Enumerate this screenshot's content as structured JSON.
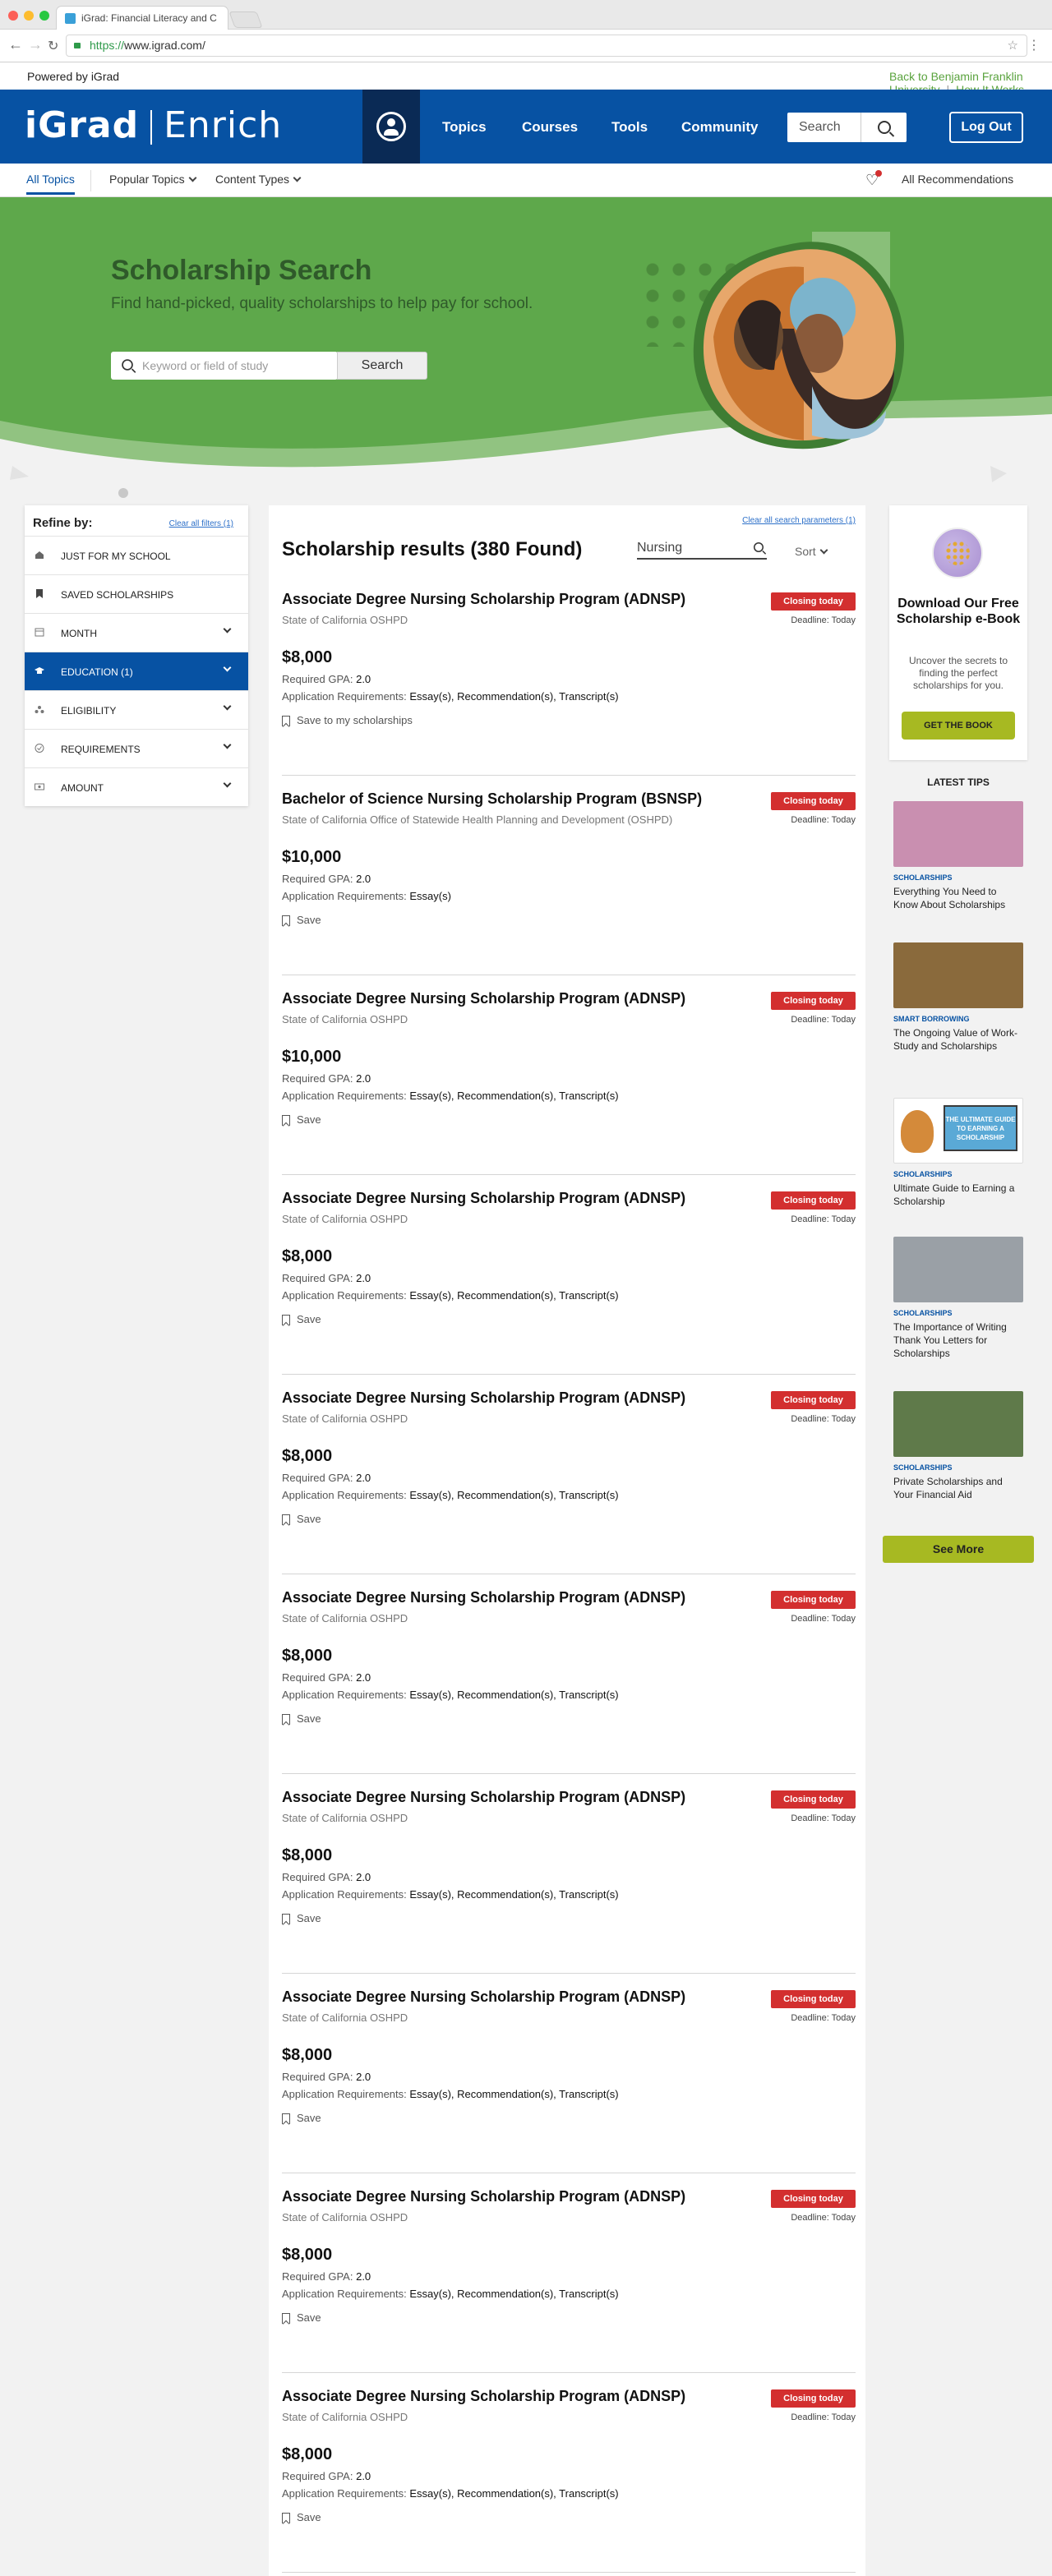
{
  "browser": {
    "tab_title": "iGrad: Financial Literacy and C",
    "url_scheme": "https://",
    "url_host": "www.igrad.com/"
  },
  "utility_bar": {
    "powered_by": "Powered by iGrad",
    "back_link": "Back to  Benjamin Franklin University",
    "how_it_works": "How It Works"
  },
  "header": {
    "logo_left": "iGrad",
    "logo_right": "Enrich",
    "nav": [
      "Topics",
      "Courses",
      "Tools",
      "Community"
    ],
    "search_placeholder": "Search",
    "logout": "Log Out"
  },
  "subnav": {
    "all_topics": "All Topics",
    "popular_topics": "Popular Topics",
    "content_types": "Content Types",
    "recommendations": "All Recommendations"
  },
  "hero": {
    "title": "Scholarship Search",
    "subtitle": "Find hand-picked, quality scholarships to help pay for school.",
    "search_placeholder": "Keyword or field of study",
    "search_button": "Search"
  },
  "filters": {
    "title": "Refine by:",
    "clear": "Clear all filters (1)",
    "items": [
      {
        "label": "JUST FOR MY SCHOOL",
        "icon": "school-icon"
      },
      {
        "label": "SAVED SCHOLARSHIPS",
        "icon": "bookmark-icon"
      },
      {
        "label": "MONTH",
        "icon": "calendar-icon"
      },
      {
        "label": "EDUCATION (1)",
        "icon": "graduation-cap-icon"
      },
      {
        "label": "ELIGIBILITY",
        "icon": "people-icon"
      },
      {
        "label": "REQUIREMENTS",
        "icon": "check-circle-icon"
      },
      {
        "label": "AMOUNT",
        "icon": "money-icon"
      }
    ]
  },
  "results": {
    "clear_params": "Clear all search parameters (1)",
    "heading": "Scholarship results (380 Found)",
    "search_value": "Nursing",
    "sort_label": "Sort",
    "cards": [
      {
        "title": "Associate Degree Nursing Scholarship Program (ADNSP)",
        "provider": "State of California OSHPD",
        "badge": "Closing today",
        "deadline": "Deadline: Today",
        "amount": "$8,000",
        "gpa_label": "Required GPA: ",
        "gpa": "2.0",
        "req_label": "Application Requirements: ",
        "req": "Essay(s), Recommendation(s), Transcript(s)",
        "save": "Save to my scholarships"
      },
      {
        "title": "Bachelor of Science Nursing Scholarship Program (BSNSP)",
        "provider": "State of California Office of Statewide Health Planning and Development (OSHPD)",
        "badge": "Closing today",
        "deadline": "Deadline: Today",
        "amount": "$10,000",
        "gpa_label": "Required GPA: ",
        "gpa": "2.0",
        "req_label": "Application Requirements: ",
        "req": "Essay(s)",
        "save": "Save"
      },
      {
        "title": "Associate Degree Nursing Scholarship Program (ADNSP)",
        "provider": "State of California OSHPD",
        "badge": "Closing today",
        "deadline": "Deadline: Today",
        "amount": "$10,000",
        "gpa_label": "Required GPA: ",
        "gpa": "2.0",
        "req_label": "Application Requirements: ",
        "req": "Essay(s), Recommendation(s), Transcript(s)",
        "save": "Save"
      },
      {
        "title": "Associate Degree Nursing Scholarship Program (ADNSP)",
        "provider": "State of California OSHPD",
        "badge": "Closing today",
        "deadline": "Deadline: Today",
        "amount": "$8,000",
        "gpa_label": "Required GPA: ",
        "gpa": "2.0",
        "req_label": "Application Requirements: ",
        "req": "Essay(s), Recommendation(s), Transcript(s)",
        "save": "Save"
      },
      {
        "title": "Associate Degree Nursing Scholarship Program (ADNSP)",
        "provider": "State of California OSHPD",
        "badge": "Closing today",
        "deadline": "Deadline: Today",
        "amount": "$8,000",
        "gpa_label": "Required GPA: ",
        "gpa": "2.0",
        "req_label": "Application Requirements: ",
        "req": "Essay(s), Recommendation(s), Transcript(s)",
        "save": "Save"
      },
      {
        "title": "Associate Degree Nursing Scholarship Program (ADNSP)",
        "provider": "State of California OSHPD",
        "badge": "Closing today",
        "deadline": "Deadline: Today",
        "amount": "$8,000",
        "gpa_label": "Required GPA: ",
        "gpa": "2.0",
        "req_label": "Application Requirements: ",
        "req": "Essay(s), Recommendation(s), Transcript(s)",
        "save": "Save"
      },
      {
        "title": "Associate Degree Nursing Scholarship Program (ADNSP)",
        "provider": "State of California OSHPD",
        "badge": "Closing today",
        "deadline": "Deadline: Today",
        "amount": "$8,000",
        "gpa_label": "Required GPA: ",
        "gpa": "2.0",
        "req_label": "Application Requirements: ",
        "req": "Essay(s), Recommendation(s), Transcript(s)",
        "save": "Save"
      },
      {
        "title": "Associate Degree Nursing Scholarship Program (ADNSP)",
        "provider": "State of California OSHPD",
        "badge": "Closing today",
        "deadline": "Deadline: Today",
        "amount": "$8,000",
        "gpa_label": "Required GPA: ",
        "gpa": "2.0",
        "req_label": "Application Requirements: ",
        "req": "Essay(s), Recommendation(s), Transcript(s)",
        "save": "Save"
      },
      {
        "title": "Associate Degree Nursing Scholarship Program (ADNSP)",
        "provider": "State of California OSHPD",
        "badge": "Closing today",
        "deadline": "Deadline: Today",
        "amount": "$8,000",
        "gpa_label": "Required GPA: ",
        "gpa": "2.0",
        "req_label": "Application Requirements: ",
        "req": "Essay(s), Recommendation(s), Transcript(s)",
        "save": "Save"
      },
      {
        "title": "Associate Degree Nursing Scholarship Program (ADNSP)",
        "provider": "State of California OSHPD",
        "badge": "Closing today",
        "deadline": "Deadline: Today",
        "amount": "$8,000",
        "gpa_label": "Required GPA: ",
        "gpa": "2.0",
        "req_label": "Application Requirements: ",
        "req": "Essay(s), Recommendation(s), Transcript(s)",
        "save": "Save"
      }
    ]
  },
  "ebook": {
    "title": "Download Our Free Scholarship e-Book",
    "text": "Uncover the secrets to finding the perfect scholarships for you.",
    "button": "GET THE BOOK"
  },
  "tips": {
    "heading": "LATEST TIPS",
    "items": [
      {
        "category": "SCHOLARSHIPS",
        "title": "Everything You Need to Know About Scholarships",
        "color": "#c98fb0"
      },
      {
        "category": "SMART BORROWING",
        "title": "The Ongoing Value of Work-Study and Scholarships",
        "color": "#8a6a3c"
      },
      {
        "category": "SCHOLARSHIPS",
        "title": "Ultimate Guide to Earning a Scholarship",
        "color": "#5aa9d6",
        "image_text": "THE ULTIMATE GUIDE TO EARNING A SCHOLARSHIP"
      },
      {
        "category": "SCHOLARSHIPS",
        "title": "The Importance of Writing Thank You Letters for Scholarships",
        "color": "#9aa0a6"
      },
      {
        "category": "SCHOLARSHIPS",
        "title": "Private Scholarships and Your Financial Aid",
        "color": "#5f7a4a"
      }
    ],
    "see_more": "See More"
  },
  "colors": {
    "brand_blue": "#0752a3",
    "hero_green": "#5ea84b",
    "badge_red": "#d32f2f",
    "accent_lime": "#a7b922"
  }
}
